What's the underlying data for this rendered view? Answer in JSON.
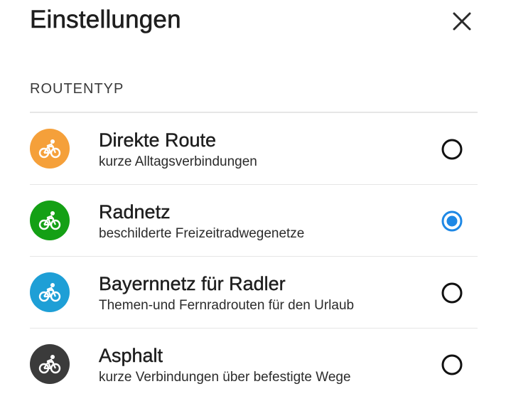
{
  "header": {
    "title": "Einstellungen",
    "close_icon": "close-icon"
  },
  "section": {
    "label": "ROUTENTYP"
  },
  "route_types": [
    {
      "title": "Direkte Route",
      "subtitle": "kurze Alltagsverbindungen",
      "icon": "bicycle-icon",
      "color": "#F5A03A",
      "selected": false
    },
    {
      "title": "Radnetz",
      "subtitle": "beschilderte Freizeitradwegenetze",
      "icon": "bicycle-icon",
      "color": "#14A015",
      "selected": true
    },
    {
      "title": "Bayernnetz für Radler",
      "subtitle": "Themen-und Fernradrouten für den Urlaub",
      "icon": "bicycle-icon",
      "color": "#1E9FD6",
      "selected": false
    },
    {
      "title": "Asphalt",
      "subtitle": "kurze Verbindungen über befestigte Wege",
      "icon": "bicycle-icon",
      "color": "#3B3B3B",
      "selected": false
    }
  ],
  "colors": {
    "radio_selected": "#1E88E5",
    "radio_unselected": "#111111",
    "divider": "#E6E6E6"
  }
}
